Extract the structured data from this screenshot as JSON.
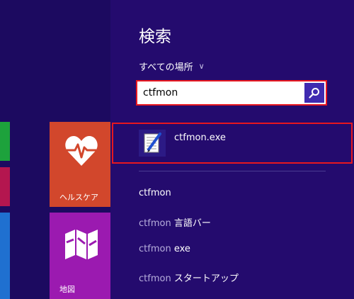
{
  "tiles": {
    "health": {
      "label": "ヘルスケア"
    },
    "maps": {
      "label": "地図"
    }
  },
  "search": {
    "title": "検索",
    "scope": "すべての場所",
    "query": "ctfmon"
  },
  "top_result": {
    "name": "ctfmon.exe"
  },
  "suggestions": [
    {
      "query": "ctfmon",
      "rest": ""
    },
    {
      "query": "ctfmon",
      "rest": " 言語バー"
    },
    {
      "query": "ctfmon",
      "rest": " exe"
    },
    {
      "query": "ctfmon",
      "rest": " スタートアップ"
    }
  ],
  "colors": {
    "start_bg": "#1c0a60",
    "charm_bg": "#240b6e",
    "highlight": "#e8171f",
    "health_tile": "#d2472c",
    "maps_tile": "#9b1ab0",
    "search_button": "#3f2ab0"
  }
}
